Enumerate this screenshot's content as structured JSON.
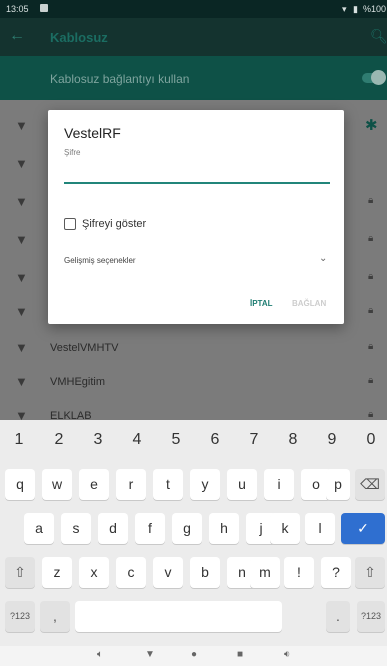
{
  "status_bar": {
    "time": "13:05",
    "battery_text": "%100"
  },
  "toolbar": {
    "title": "Kablosuz"
  },
  "wifi_toggle": {
    "label": "Kablosuz bağlantıyı kullan"
  },
  "networks": [
    {
      "name": "VestelVMHTV",
      "locked": true
    },
    {
      "name": "VMHEgitim",
      "locked": true
    },
    {
      "name": "ELKLAB",
      "locked": true
    }
  ],
  "dialog": {
    "title": "VestelRF",
    "password_label": "Şifre",
    "password_value": "",
    "show_password_label": "Şifreyi göster",
    "show_password_checked": false,
    "advanced_label": "Gelişmiş seçenekler",
    "cancel_label": "İPTAL",
    "connect_label": "BAĞLAN"
  },
  "keyboard": {
    "numbers": [
      "1",
      "2",
      "3",
      "4",
      "5",
      "6",
      "7",
      "8",
      "9",
      "0"
    ],
    "row1": [
      "q",
      "w",
      "e",
      "r",
      "t",
      "y",
      "u",
      "i",
      "o",
      "p"
    ],
    "row2": [
      "a",
      "s",
      "d",
      "f",
      "g",
      "h",
      "j",
      "k",
      "l"
    ],
    "row3": [
      "z",
      "x",
      "c",
      "v",
      "b",
      "n",
      "m",
      "!",
      "?"
    ],
    "symbols_label": "?123",
    "comma": ",",
    "period": "."
  },
  "icons": {
    "back": "arrow-left-icon",
    "search": "search-icon",
    "settings": "gear-icon",
    "wifi": "wifi-icon",
    "lock": "lock-icon"
  },
  "colors": {
    "accent": "#21857a",
    "enter_key": "#2f6fd0"
  }
}
